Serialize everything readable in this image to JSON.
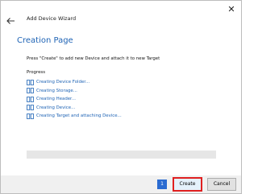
{
  "window": {
    "close_glyph": "✕"
  },
  "header": {
    "back_icon": "back-arrow-icon",
    "wizard_title": "Add Device Wizard"
  },
  "page": {
    "title": "Creation Page",
    "instruction": "Press \"Create\" to add new Device and attach it to new Target",
    "progress_heading": "Progress"
  },
  "steps": [
    {
      "label": "Creating Device Folder...",
      "icon": "task-step-icon"
    },
    {
      "label": "Creating Storage...",
      "icon": "task-step-icon"
    },
    {
      "label": "Creating Header...",
      "icon": "task-step-icon"
    },
    {
      "label": "Creating Device...",
      "icon": "task-step-icon"
    },
    {
      "label": "Creating Target and attaching Device...",
      "icon": "task-step-icon"
    }
  ],
  "progress": {
    "fraction": 0
  },
  "footer": {
    "help_badge": "1",
    "create_label": "Create",
    "cancel_label": "Cancel"
  },
  "colors": {
    "accent": "#1e63b5",
    "highlight": "#e02020",
    "progress_track": "#e6e6e6"
  }
}
